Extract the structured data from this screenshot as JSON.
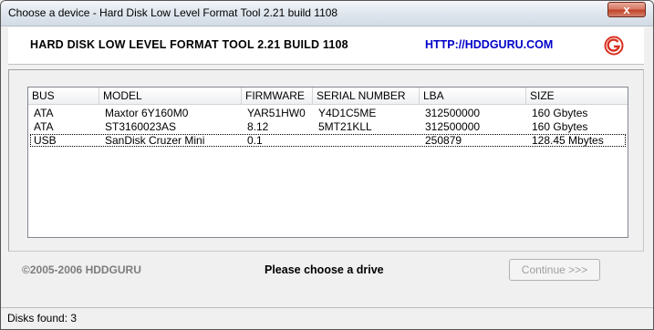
{
  "window": {
    "title": "Choose a device - Hard Disk Low Level Format Tool 2.21 build 1108",
    "close_label": "x"
  },
  "header": {
    "title": "HARD DISK LOW LEVEL FORMAT TOOL 2.21 BUILD 1108",
    "link": "HTTP://HDDGURU.COM"
  },
  "table": {
    "columns": [
      "BUS",
      "MODEL",
      "FIRMWARE",
      "SERIAL NUMBER",
      "LBA",
      "SIZE"
    ],
    "rows": [
      {
        "bus": "ATA",
        "model": "Maxtor 6Y160M0",
        "firmware": "YAR51HW0",
        "serial": "Y4D1C5ME",
        "lba": "312500000",
        "size": "160 Gbytes"
      },
      {
        "bus": "ATA",
        "model": "ST3160023AS",
        "firmware": "8.12",
        "serial": "5MT21KLL",
        "lba": "312500000",
        "size": "160 Gbytes"
      },
      {
        "bus": "USB",
        "model": "SanDisk Cruzer Mini",
        "firmware": "0.1",
        "serial": "",
        "lba": "250879",
        "size": "128.45 Mbytes"
      }
    ]
  },
  "footer": {
    "copyright": "©2005-2006 HDDGURU",
    "prompt": "Please choose a drive",
    "continue_label": "Continue >>>"
  },
  "status": {
    "text": "Disks found: 3"
  },
  "colors": {
    "link": "#0000c8",
    "logo_red": "#d9301f"
  }
}
